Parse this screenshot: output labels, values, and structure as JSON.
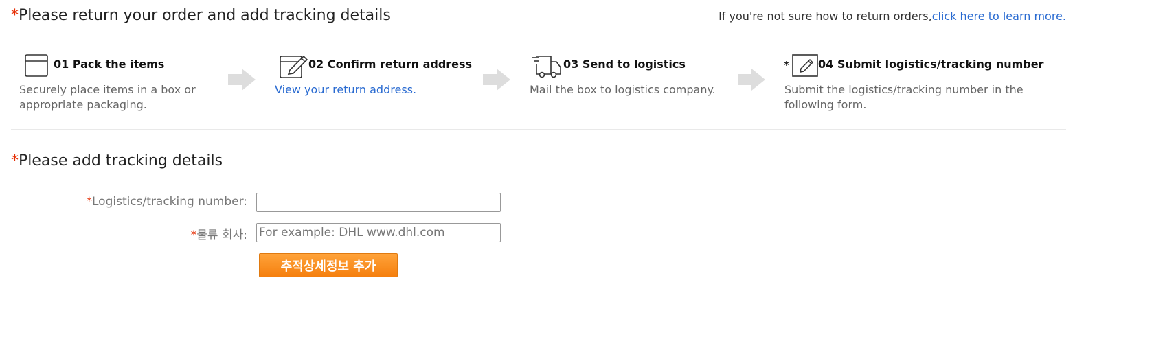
{
  "header": {
    "required_mark": "*",
    "title": "Please return your order and add tracking details",
    "help_text": "If you're not sure how to return orders,",
    "help_link": "click here to learn more."
  },
  "steps": [
    {
      "icon": "box-icon",
      "title": "01 Pack the items",
      "desc": "Securely place items in a box or appropriate packaging."
    },
    {
      "icon": "edit-address-icon",
      "title": "02 Confirm return address",
      "desc": "View your return address."
    },
    {
      "icon": "truck-icon",
      "title": "03 Send to logistics",
      "desc": "Mail the box to logistics company."
    },
    {
      "icon": "pencil-icon",
      "prefix": "*",
      "title": "04 Submit logistics/tracking number",
      "desc": "Submit the logistics/tracking number in the following form."
    }
  ],
  "form": {
    "required_mark": "*",
    "title": "Please add tracking details",
    "tracking_label": "Logistics/tracking number:",
    "tracking_value": "",
    "company_label": "물류 회사:",
    "company_placeholder": "For example: DHL www.dhl.com",
    "submit_label": "추적상세정보 추가"
  },
  "colors": {
    "accent": "#e62e04",
    "link": "#2a6bd1",
    "button": "#f68b1f",
    "arrow": "#dddddd"
  }
}
